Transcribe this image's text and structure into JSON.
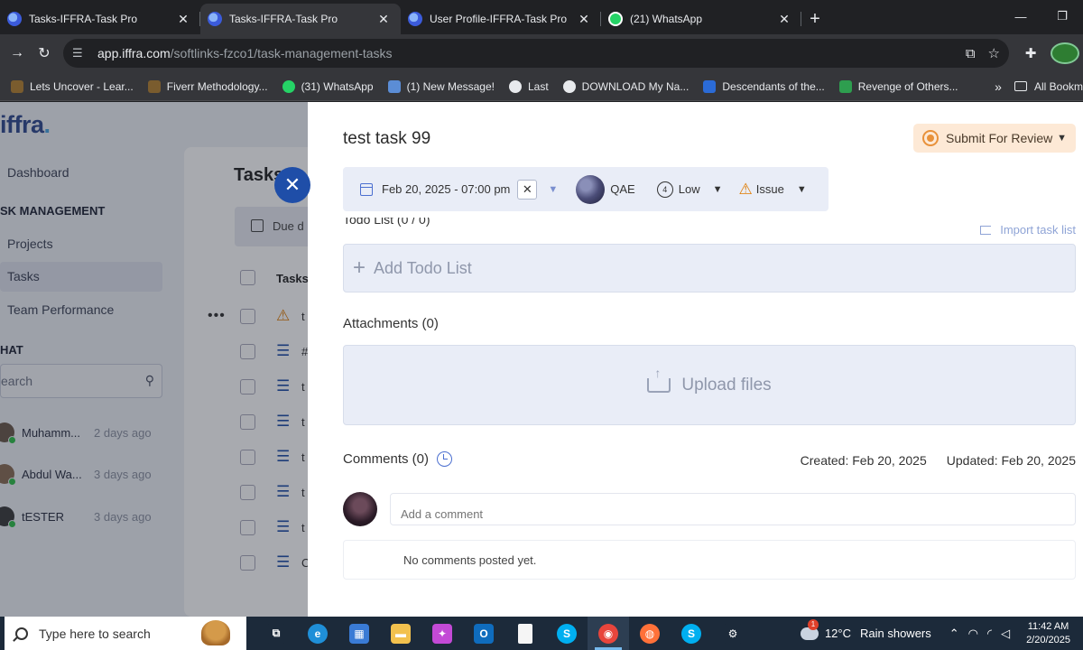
{
  "browser": {
    "tabs": [
      {
        "title": "Tasks-IFFRA-Task Pro",
        "favicon": "iffra-favicon",
        "active": false
      },
      {
        "title": "Tasks-IFFRA-Task Pro",
        "favicon": "iffra-favicon",
        "active": true
      },
      {
        "title": "User Profile-IFFRA-Task Pro",
        "favicon": "iffra-favicon",
        "active": false
      },
      {
        "title": "(21) WhatsApp",
        "favicon": "whatsapp-favicon",
        "active": false
      }
    ],
    "url_host": "app.iffra.com",
    "url_path": "/softlinks-fzco1/task-management-tasks",
    "bookmarks": [
      {
        "label": "Lets Uncover - Lear...",
        "color": "#7a5c2e"
      },
      {
        "label": "Fiverr Methodology...",
        "color": "#7a5c2e"
      },
      {
        "label": "(31) WhatsApp",
        "color": "#25d366"
      },
      {
        "label": "(1) New Message!",
        "color": "#5b8dd6"
      },
      {
        "label": "Last",
        "color": "#e8eaed"
      },
      {
        "label": "DOWNLOAD My Na...",
        "color": "#e8eaed"
      },
      {
        "label": "Descendants of the...",
        "color": "#2b6bd6"
      },
      {
        "label": "Revenge of Others...",
        "color": "#2e9e4f"
      }
    ],
    "all_bookmarks": "All Bookm"
  },
  "sidebar": {
    "logo_text": "iffra",
    "logo_dot": ".",
    "items": [
      {
        "label": "Dashboard"
      },
      {
        "label": "Projects"
      },
      {
        "label": "Tasks"
      },
      {
        "label": "Team Performance"
      }
    ],
    "section_task": "SK MANAGEMENT",
    "section_chat": "HAT",
    "search_placeholder": "earch",
    "chats": [
      {
        "name": "Muhamm...",
        "time": "2 days ago"
      },
      {
        "name": "Abdul Wa...",
        "time": "3 days ago"
      },
      {
        "name": "tESTER",
        "time": "3 days ago"
      }
    ]
  },
  "main": {
    "title": "Tasks",
    "filter_label": "Due d",
    "column_header": "Tasks",
    "rows": [
      "t",
      "#",
      "t",
      "t",
      "t",
      "t",
      "t",
      "C"
    ]
  },
  "drawer": {
    "task_title": "test task 99",
    "submit_label": "Submit For Review",
    "due_date": "Feb 20, 2025 - 07:00 pm",
    "assignee": "QAE",
    "priority": "Low",
    "priority_icon_text": "4",
    "type": "Issue",
    "todo_heading": "Todo List (0 / 0)",
    "import_label": "Import task list",
    "add_todo_label": "Add Todo List",
    "attachments_heading": "Attachments (0)",
    "upload_label": "Upload files",
    "comments_heading": "Comments (0)",
    "created": "Created: Feb 20, 2025",
    "updated": "Updated: Feb 20, 2025",
    "comment_placeholder": "Add a comment",
    "no_comments": "No comments posted yet."
  },
  "taskbar": {
    "search_placeholder": "Type here to search",
    "apps": [
      {
        "name": "task-view-icon",
        "color": "#1c2a3a",
        "glyph": "⧉"
      },
      {
        "name": "edge-icon",
        "color": "#1f8fd8",
        "glyph": "e"
      },
      {
        "name": "store-icon",
        "color": "#3a7bd5",
        "glyph": "▦"
      },
      {
        "name": "explorer-icon",
        "color": "#f2c14e",
        "glyph": "▬"
      },
      {
        "name": "copilot-icon",
        "color": "#c34ad6",
        "glyph": "✦"
      },
      {
        "name": "outlook-icon",
        "color": "#0f6cbd",
        "glyph": "O"
      },
      {
        "name": "notepad-icon",
        "color": "#f5f5f5",
        "glyph": ""
      },
      {
        "name": "skype-icon",
        "color": "#00aff0",
        "glyph": "S"
      },
      {
        "name": "chrome-icon",
        "color": "#e8453c",
        "glyph": "◉"
      },
      {
        "name": "firefox-icon",
        "color": "#ff7139",
        "glyph": "◍"
      },
      {
        "name": "skype-icon-2",
        "color": "#00aff0",
        "glyph": "S"
      },
      {
        "name": "settings-icon",
        "color": "#1c2a3a",
        "glyph": "⚙"
      }
    ],
    "temperature": "12°C",
    "weather": "Rain showers",
    "time": "11:42 AM",
    "date": "2/20/2025"
  }
}
